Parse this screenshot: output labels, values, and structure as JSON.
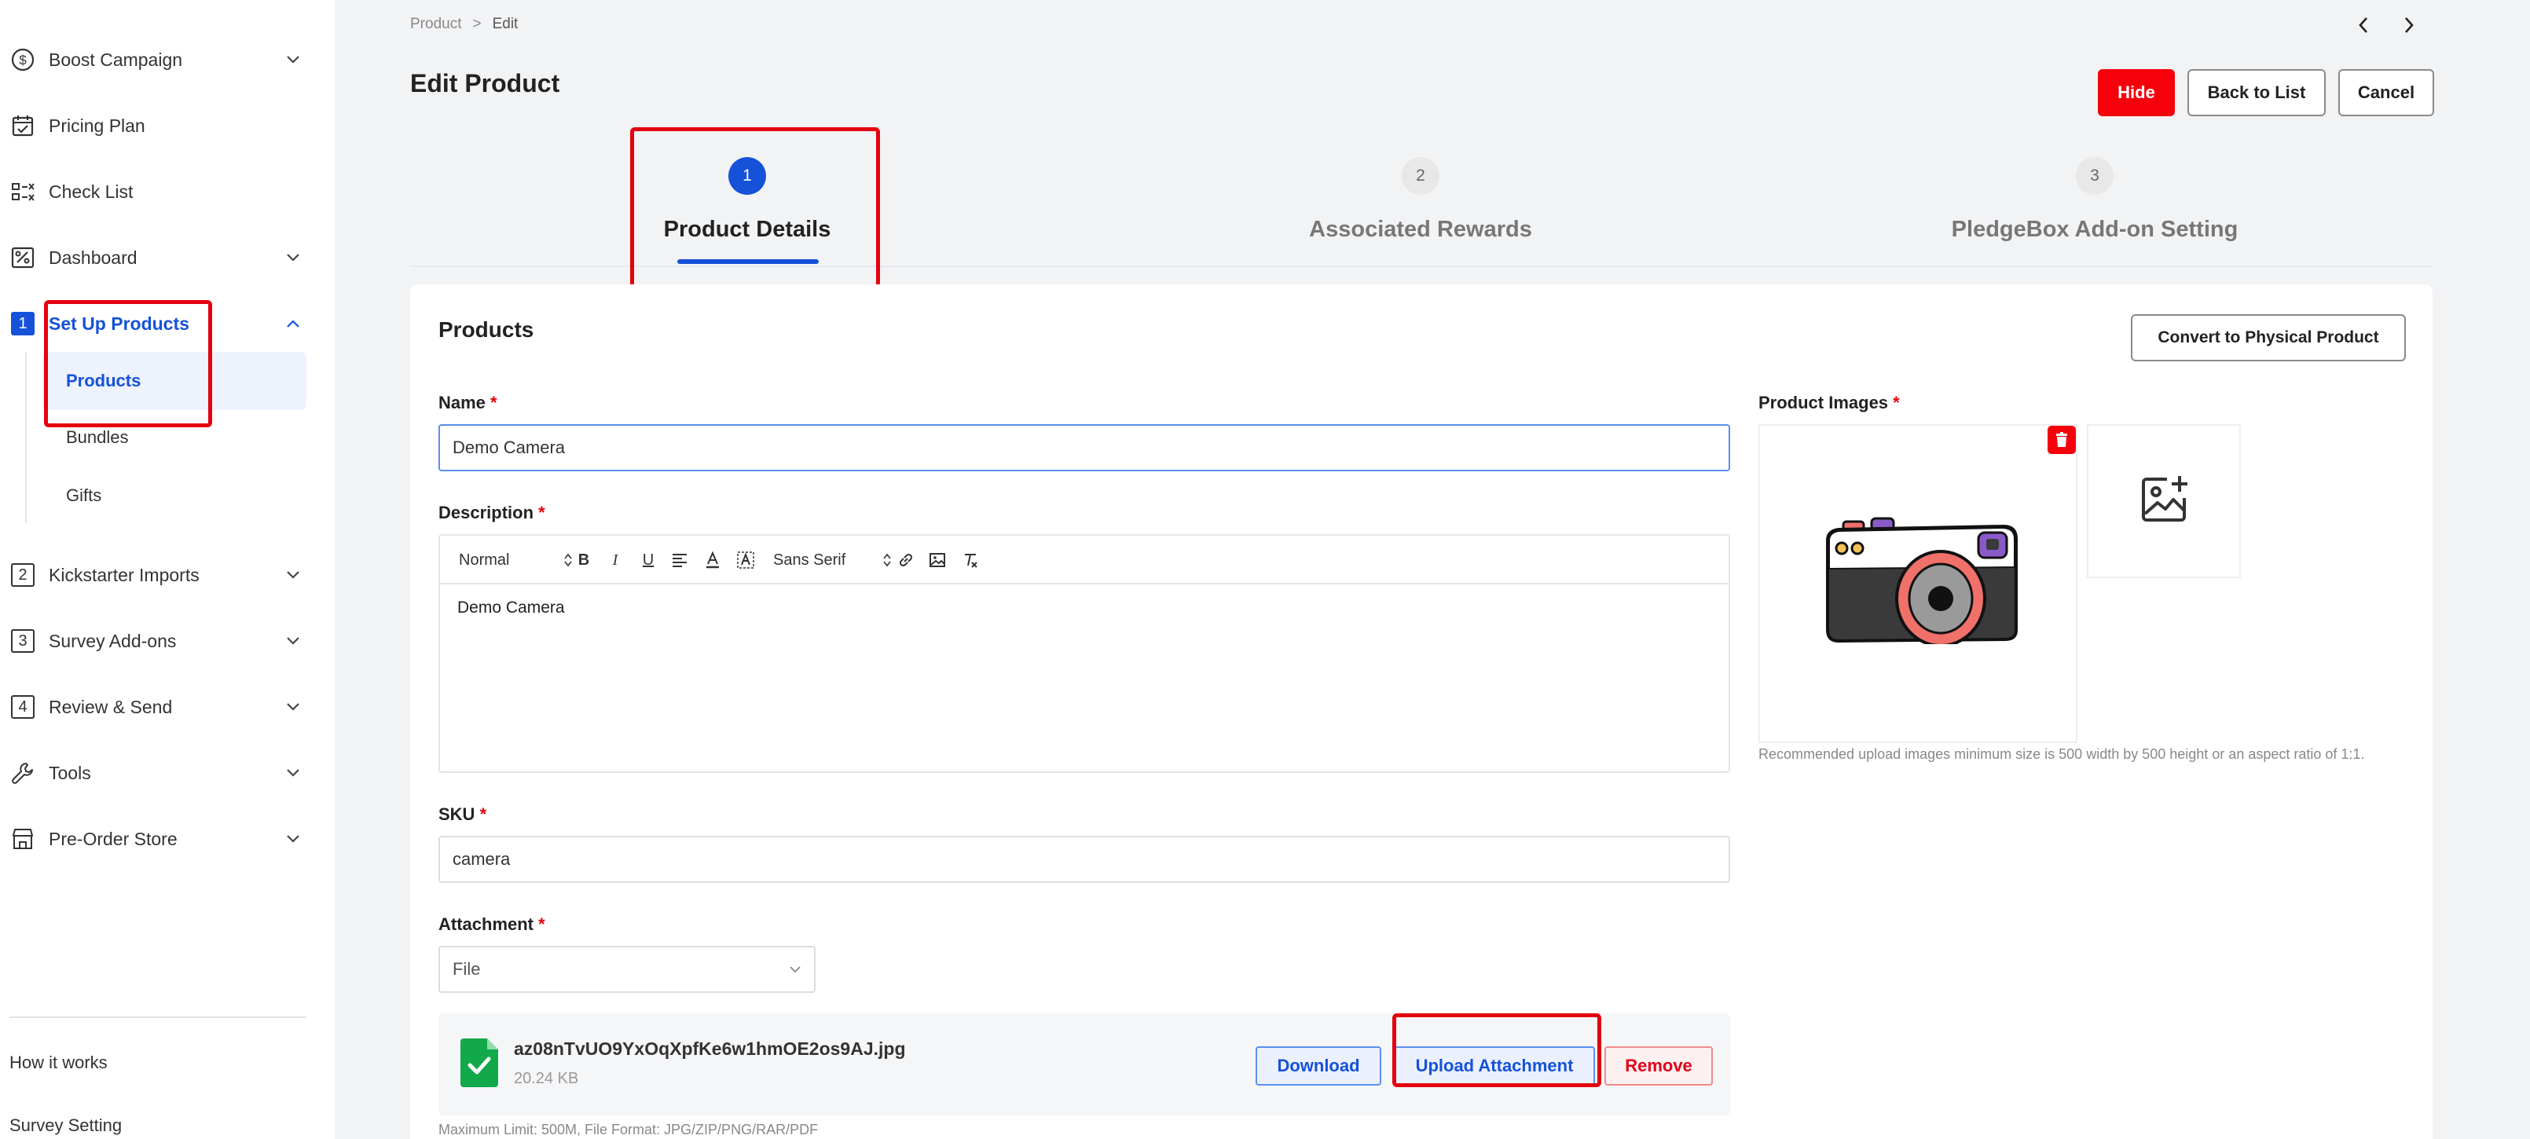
{
  "sidebar": {
    "items": [
      {
        "label": "Boost Campaign",
        "icon": "dollar-coin-icon"
      },
      {
        "label": "Pricing Plan",
        "icon": "calendar-check-icon"
      },
      {
        "label": "Check List",
        "icon": "checklist-icon"
      },
      {
        "label": "Dashboard",
        "icon": "percent-chart-icon"
      },
      {
        "label": "Set Up Products",
        "number": "1"
      },
      {
        "label": "Kickstarter Imports",
        "number": "2"
      },
      {
        "label": "Survey Add-ons",
        "number": "3"
      },
      {
        "label": "Review & Send",
        "number": "4"
      },
      {
        "label": "Tools",
        "icon": "wrench-icon"
      },
      {
        "label": "Pre-Order Store",
        "icon": "store-icon"
      }
    ],
    "sub_items": [
      "Products",
      "Bundles",
      "Gifts"
    ],
    "footer_links": [
      "How it works",
      "Survey Setting"
    ]
  },
  "breadcrumb": {
    "root": "Product",
    "separator": ">",
    "current": "Edit"
  },
  "header": {
    "title": "Edit Product",
    "hide_label": "Hide",
    "back_label": "Back to List",
    "cancel_label": "Cancel"
  },
  "steps": [
    {
      "number": "1",
      "label": "Product Details",
      "active": true
    },
    {
      "number": "2",
      "label": "Associated Rewards",
      "active": false
    },
    {
      "number": "3",
      "label": "PledgeBox Add-on Setting",
      "active": false
    }
  ],
  "card": {
    "title": "Products",
    "convert_label": "Convert to Physical Product"
  },
  "form": {
    "name_label": "Name",
    "name_value": "Demo Camera",
    "description_label": "Description",
    "toolbar_format": "Normal",
    "toolbar_font": "Sans Serif",
    "description_value": "Demo Camera",
    "sku_label": "SKU",
    "sku_value": "camera",
    "attachment_label": "Attachment",
    "attachment_type": "File",
    "required_mark": "*"
  },
  "attachment": {
    "file_name": "az08nTvUO9YxOqXpfKe6w1hmOE2os9AJ.jpg",
    "file_size": "20.24 KB",
    "download_label": "Download",
    "upload_label": "Upload Attachment",
    "remove_label": "Remove",
    "limit_hint": "Maximum Limit: 500M, File Format: JPG/ZIP/PNG/RAR/PDF"
  },
  "images": {
    "label": "Product Images",
    "hint": "Recommended upload images minimum size is 500 width by 500 height or an aspect ratio of 1:1."
  },
  "colors": {
    "accent": "#1552d9",
    "danger": "#f5000b",
    "highlight": "#e3000f"
  }
}
